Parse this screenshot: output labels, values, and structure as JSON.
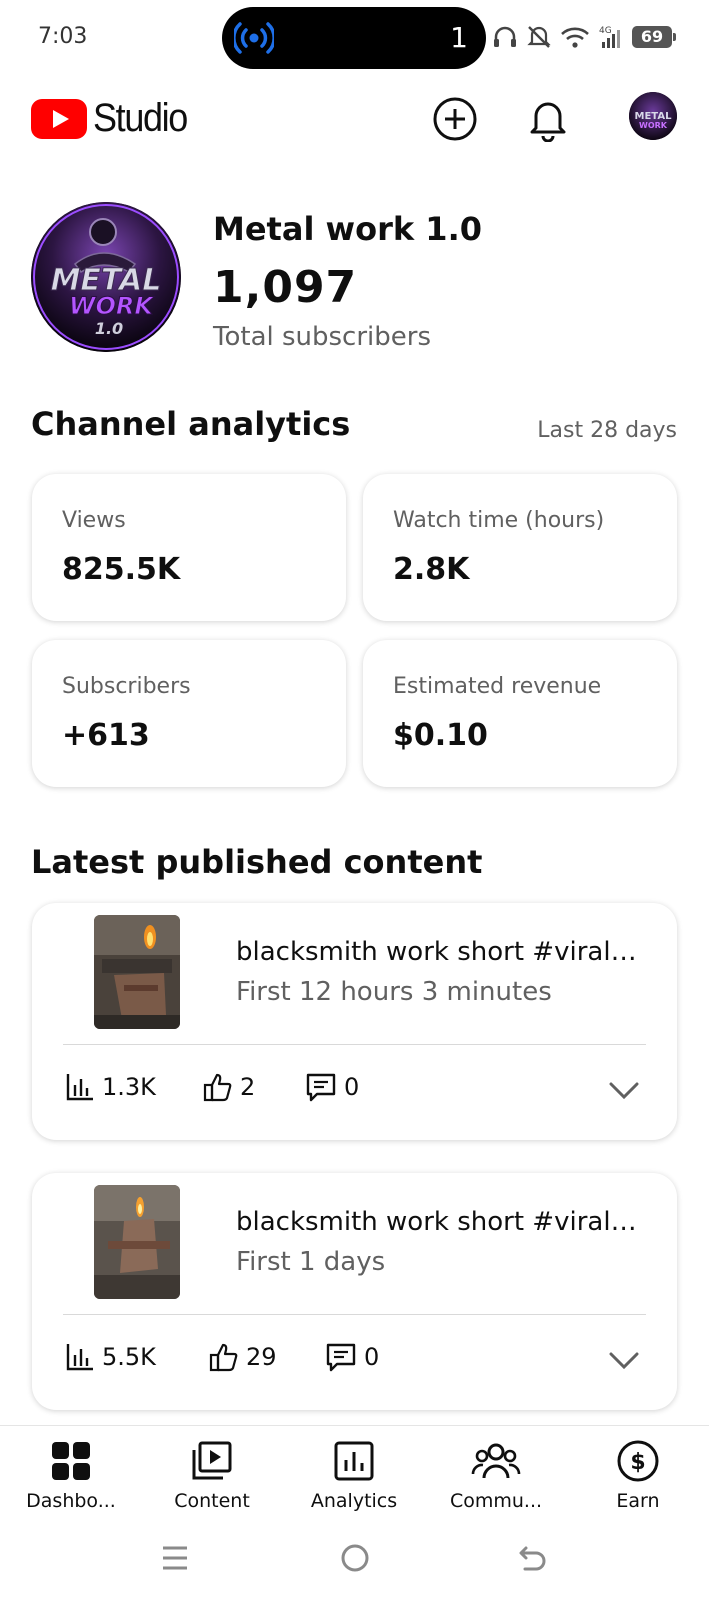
{
  "status_bar": {
    "time": "7:03",
    "island_count": "1",
    "battery": "69",
    "network_label": "4G"
  },
  "header": {
    "brand": "Studio",
    "create_icon": "add-circle-icon",
    "notifications_icon": "bell-icon"
  },
  "channel": {
    "name": "Metal work 1.0",
    "subscribers": "1,097",
    "subscribers_label": "Total subscribers",
    "avatar_text": [
      "METAL",
      "WORK",
      "1.0"
    ]
  },
  "analytics": {
    "title": "Channel analytics",
    "period": "Last 28 days",
    "stats": [
      {
        "label": "Views",
        "value": "825.5K"
      },
      {
        "label": "Watch time (hours)",
        "value": "2.8K"
      },
      {
        "label": "Subscribers",
        "value": "+613"
      },
      {
        "label": "Estimated revenue",
        "value": "$0.10"
      }
    ]
  },
  "latest": {
    "title": "Latest published content",
    "videos": [
      {
        "title": "blacksmith work short #viral #shorts #youtube",
        "subtitle": "First 12 hours 3 minutes",
        "views": "1.3K",
        "likes": "2",
        "comments": "0"
      },
      {
        "title": "blacksmith work short #viral #shorts #youtube",
        "subtitle": "First 1 days",
        "views": "5.5K",
        "likes": "29",
        "comments": "0"
      }
    ]
  },
  "nav": [
    {
      "label": "Dashbo...",
      "icon": "dashboard-icon"
    },
    {
      "label": "Content",
      "icon": "content-icon"
    },
    {
      "label": "Analytics",
      "icon": "analytics-icon"
    },
    {
      "label": "Commu...",
      "icon": "community-icon"
    },
    {
      "label": "Earn",
      "icon": "earn-icon"
    }
  ],
  "colors": {
    "brand_red": "#ff0000",
    "text_primary": "#0f0f0f",
    "text_secondary": "#606060",
    "island_accent": "#1e6fe8"
  }
}
